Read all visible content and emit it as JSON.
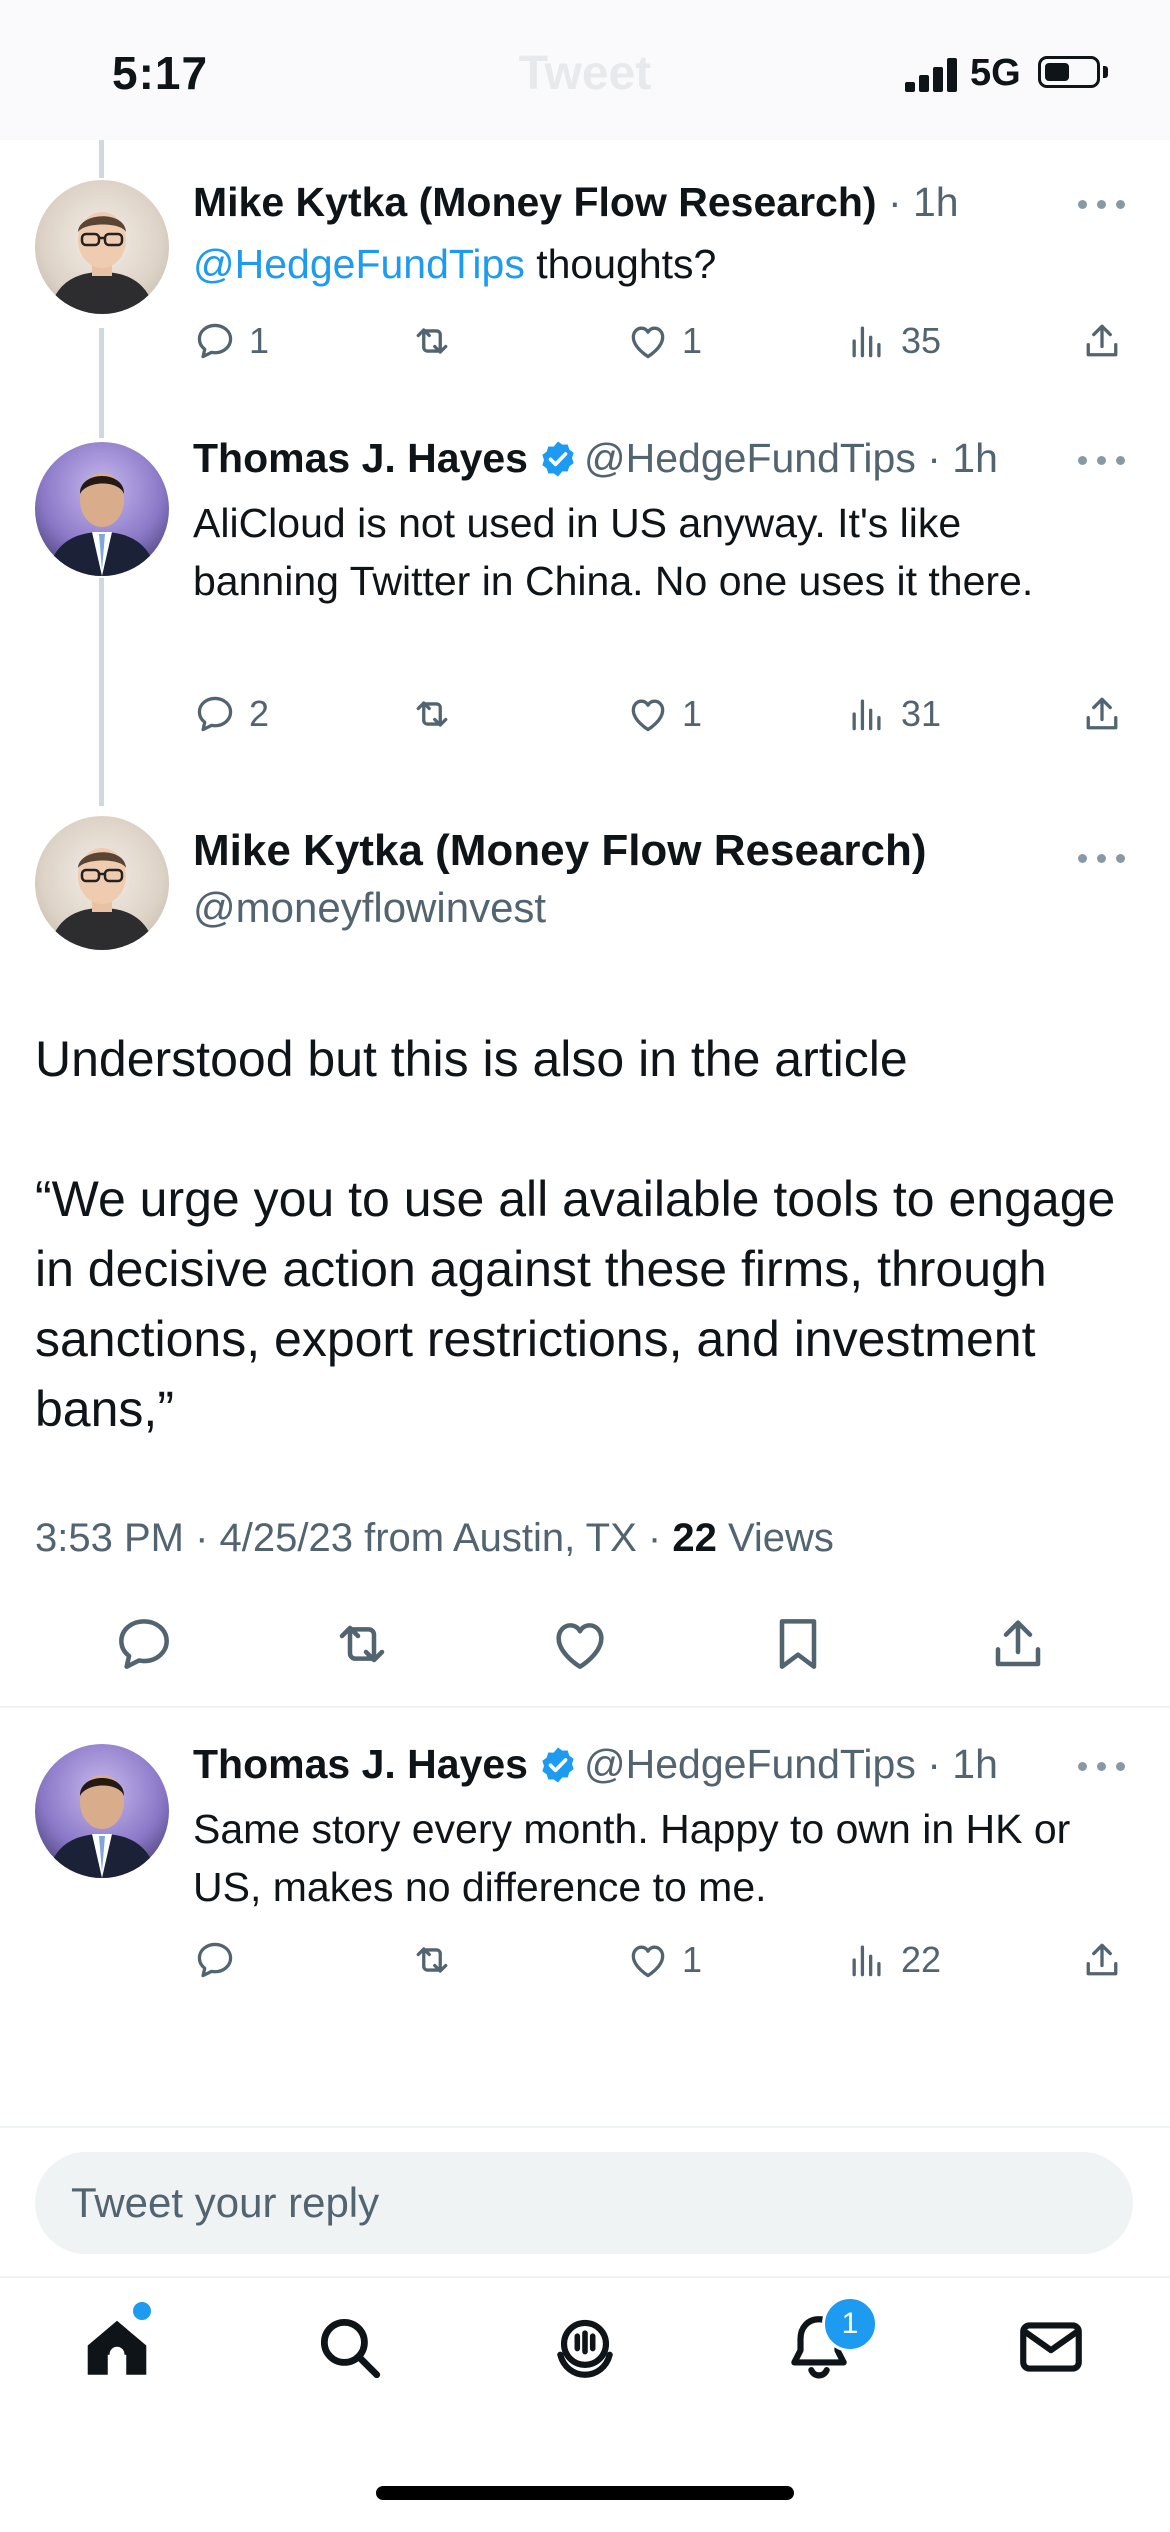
{
  "status_bar": {
    "time": "5:17",
    "network": "5G",
    "header_title_ghost": "Tweet"
  },
  "thread": [
    {
      "name": "Mike Kytka (Money Flow Research)",
      "handle": "",
      "time": "· 1h",
      "mention": "@HedgeFundTips",
      "text": " thoughts?",
      "replies": "1",
      "retweets": "",
      "likes": "1",
      "views": "35"
    },
    {
      "name": "Thomas J. Hayes",
      "verified": true,
      "handle": "@HedgeFundTips",
      "time": "· 1h",
      "text": "AliCloud is not used in US anyway.  It's like banning Twitter in China.  No one uses it there.",
      "replies": "2",
      "retweets": "",
      "likes": "1",
      "views": "31"
    }
  ],
  "main_tweet": {
    "name": "Mike Kytka (Money Flow Research)",
    "handle": "@moneyflowinvest",
    "paragraph1": "Understood but this is also in the article",
    "paragraph2": "“We urge you to use all available tools to engage in decisive action against these firms, through sanctions, export restrictions, and investment bans,”",
    "meta_prefix": "3:53 PM · 4/25/23 from Austin, TX · ",
    "views_count": "22",
    "views_label": " Views"
  },
  "reply": {
    "name": "Thomas J. Hayes",
    "verified": true,
    "handle": "@HedgeFundTips",
    "time": "· 1h",
    "text": "Same story every month.  Happy to own in HK or US, makes no difference to me.",
    "replies": "",
    "retweets": "",
    "likes": "1",
    "views": "22"
  },
  "composer": {
    "placeholder": "Tweet your reply"
  },
  "tab_bar": {
    "notifications_badge": "1"
  },
  "colors": {
    "accent": "#1d9bf0",
    "text": "#0f1419",
    "secondary": "#536471",
    "divider": "#eff3f4"
  },
  "icons": [
    "home-icon",
    "search-icon",
    "spaces-icon",
    "bell-icon",
    "mail-icon",
    "reply-icon",
    "retweet-icon",
    "like-icon",
    "views-icon",
    "share-icon",
    "bookmark-icon",
    "verified-icon",
    "more-icon"
  ]
}
